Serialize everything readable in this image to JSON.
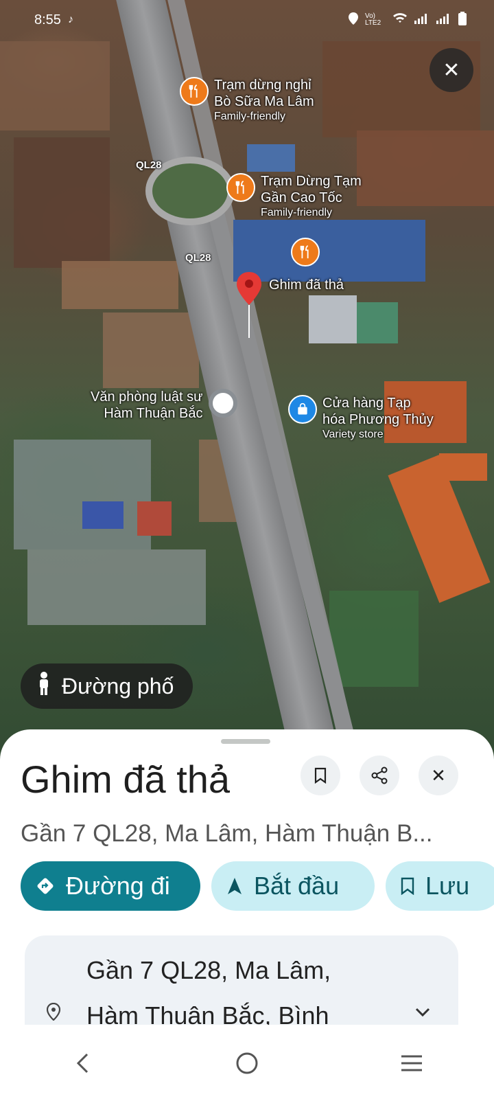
{
  "status_bar": {
    "time": "8:55",
    "network_label": "Vo) LTE2"
  },
  "map": {
    "road_labels": [
      "QL28",
      "QL28"
    ],
    "pois": [
      {
        "title_line1": "Trạm dừng nghỉ",
        "title_line2": "Bò Sữa Ma Lâm",
        "subtitle": "Family-friendly",
        "icon": "restaurant-icon"
      },
      {
        "title_line1": "Trạm Dừng Tạm",
        "title_line2": "Gần Cao Tốc",
        "subtitle": "Family-friendly",
        "icon": "restaurant-icon"
      },
      {
        "icon": "restaurant-icon"
      },
      {
        "title_line1": "Văn phòng luật sư",
        "title_line2": "Hàm Thuận Bắc",
        "icon": "place-icon"
      },
      {
        "title_line1": "Cửa hàng Tạp",
        "title_line2": "hóa Phương Thủy",
        "subtitle": "Variety store",
        "icon": "shopping-bag-icon"
      }
    ],
    "dropped_pin_label": "Ghim đã thả",
    "street_view_label": "Đường phố"
  },
  "sheet": {
    "title": "Ghim đã thả",
    "address_short": "Gần 7 QL28, Ma Lâm, Hàm Thuận B...",
    "actions": {
      "directions": "Đường đi",
      "start": "Bắt đầu",
      "save": "Lưu"
    },
    "address_line1": "Gần 7 QL28, Ma Lâm,",
    "address_line2": "Hàm Thuận Bắc, Bình"
  },
  "colors": {
    "primary": "#0f7f8f",
    "secondary_chip": "#c9eef4",
    "poi_orange": "#ee7a1a",
    "pin_red": "#e53935"
  }
}
